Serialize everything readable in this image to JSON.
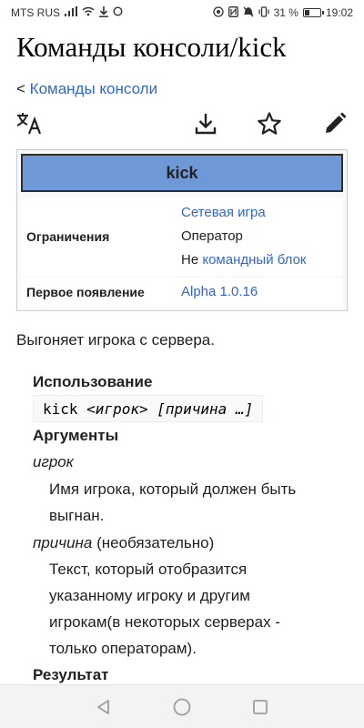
{
  "status_bar": {
    "carrier": "MTS RUS",
    "battery": "31 %",
    "time": "19:02"
  },
  "page": {
    "title": "Команды консоли/kick",
    "breadcrumb_prefix": "<",
    "breadcrumb_link": "Команды консоли"
  },
  "toolbar": {
    "icons": [
      "translate-icon",
      "download-icon",
      "star-icon",
      "edit-icon"
    ]
  },
  "infobox": {
    "header": "kick",
    "restrictions_label": "Ограничения",
    "restrictions": {
      "item1": "Сетевая игра",
      "item2": "Оператор",
      "item3_prefix": "Не",
      "item3_link": "командный блок"
    },
    "first_label": "Первое появление",
    "first_value": "Alpha 1.0.16",
    "header_color": "#6f99d6"
  },
  "article": {
    "intro": "Выгоняет игрока с сервера.",
    "usage_heading": "Использование",
    "usage_cmd": "kick",
    "usage_arg1": "<игрок>",
    "usage_arg2": "[причина …]",
    "args_heading": "Аргументы",
    "arg1_name": "игрок",
    "arg1_desc": "Имя игрока, который должен быть выгнан.",
    "arg2_name": "причина",
    "arg2_optional": "(необязательно)",
    "arg2_desc": "Текст, который отобразится указанному игроку и другим игрокам(в некоторых серверах - только операторам).",
    "result_heading": "Результат"
  },
  "colors": {
    "link": "#3366cc",
    "text": "#202122"
  }
}
